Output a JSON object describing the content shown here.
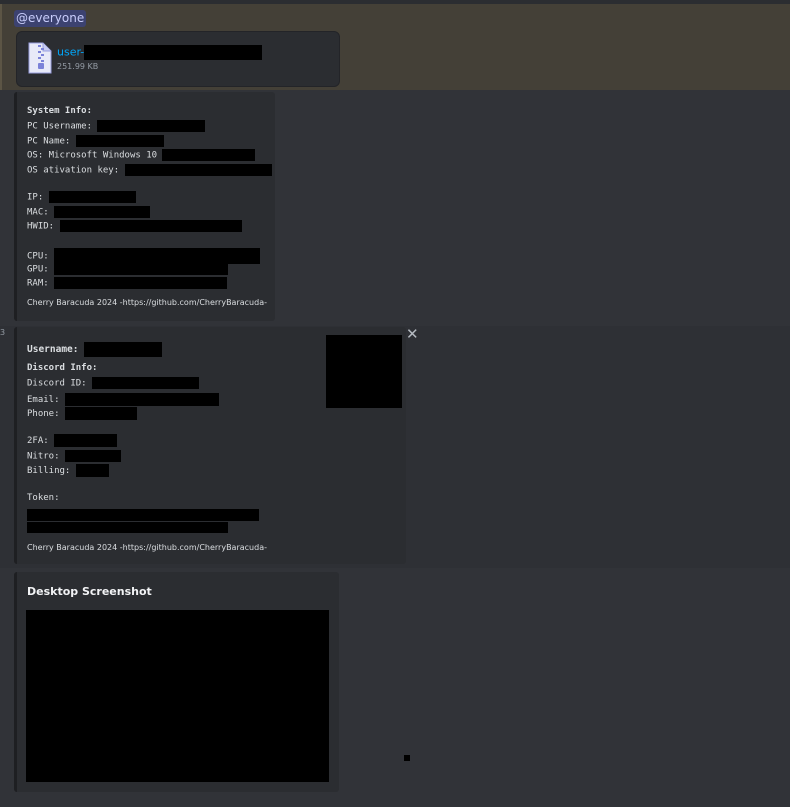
{
  "mention_message": {
    "mention": "@everyone",
    "attachment": {
      "icon": "zip-file-icon",
      "name_prefix": "user-",
      "size": "251.99 KB"
    }
  },
  "system_embed": {
    "header": "System Info:",
    "fields": {
      "pc_username": "PC Username:",
      "pc_name": "PC Name:",
      "os": "OS: Microsoft Windows 10",
      "os_key": "OS ativation key:",
      "ip": "IP:",
      "mac": "MAC:",
      "hwid": "HWID:",
      "cpu": "CPU:",
      "gpu": "GPU:",
      "ram": "RAM:"
    },
    "footer": "Cherry Baracuda 2024 -https://github.com/CherryBaracuda-"
  },
  "discord_embed": {
    "line_marker": "3",
    "username_label": "Username:",
    "discord_info_header": "Discord Info:",
    "fields": {
      "discord_id": "Discord ID:",
      "email": "Email:",
      "phone": "Phone:",
      "twofa": "2FA:",
      "nitro": "Nitro:",
      "billing": "Billing:",
      "token": "Token:"
    },
    "footer": "Cherry Baracuda 2024 -https://github.com/CherryBaracuda-",
    "close_glyph": "✕"
  },
  "screenshot_embed": {
    "title": "Desktop Screenshot"
  },
  "colors": {
    "background": "#313338",
    "embed": "#2b2d31",
    "mention_highlight": "#444037",
    "link": "#00a8fc",
    "mention_pill": "#3c4270"
  }
}
